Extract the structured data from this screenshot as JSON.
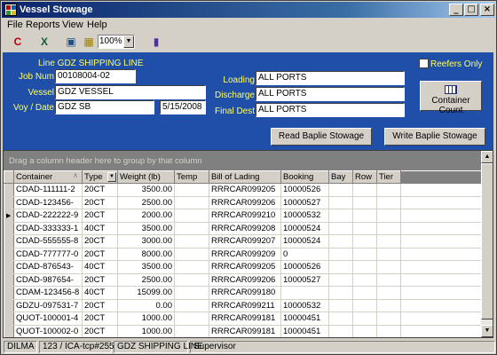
{
  "window": {
    "title": "Vessel Stowage"
  },
  "menu": [
    "File",
    "Reports",
    "View",
    "Help"
  ],
  "toolbar": {
    "zoom": "100%"
  },
  "header": {
    "line_label": "Line GDZ SHIPPING LINE",
    "job_label": "Job Num",
    "job_value": "00108004-02",
    "vessel_label": "Vessel",
    "vessel_value": "GDZ VESSEL",
    "voy_label": "Voy / Date",
    "voy_value": "GDZ SB",
    "date_value": "5/15/2008",
    "loading_label": "Loading",
    "loading_value": "ALL PORTS",
    "discharge_label": "Discharge",
    "discharge_value": "ALL PORTS",
    "finaldest_label": "Final Dest",
    "finaldest_value": "ALL PORTS",
    "reefers_label": "Reefers Only",
    "container_count_label": "Container Count",
    "read_baplie_label": "Read Baplie Stowage",
    "write_baplie_label": "Write Baplie Stowage"
  },
  "grid": {
    "group_hint": "Drag a column header here to group by that column",
    "columns": [
      "Container",
      "Type",
      "Weight (lb)",
      "Temp",
      "Bill of Lading",
      "Booking",
      "Bay",
      "Row",
      "Tier"
    ],
    "rows": [
      [
        "CDAD-111111-2",
        "20CT",
        "3500.00",
        "",
        "RRRCAR099205",
        "10000526",
        "",
        "",
        ""
      ],
      [
        "CDAD-123456-",
        "20CT",
        "2500.00",
        "",
        "RRRCAR099206",
        "10000527",
        "",
        "",
        ""
      ],
      [
        "CDAD-222222-9",
        "20CT",
        "2000.00",
        "",
        "RRRCAR099210",
        "10000532",
        "",
        "",
        ""
      ],
      [
        "CDAD-333333-1",
        "40CT",
        "3500.00",
        "",
        "RRRCAR099208",
        "10000524",
        "",
        "",
        ""
      ],
      [
        "CDAD-555555-8",
        "20CT",
        "3000.00",
        "",
        "RRRCAR099207",
        "10000524",
        "",
        "",
        ""
      ],
      [
        "CDAD-777777-0",
        "20CT",
        "8000.00",
        "",
        "RRRCAR099209",
        "0",
        "",
        "",
        ""
      ],
      [
        "CDAD-876543-",
        "40CT",
        "3500.00",
        "",
        "RRRCAR099205",
        "10000526",
        "",
        "",
        ""
      ],
      [
        "CDAD-987654-",
        "20CT",
        "2500.00",
        "",
        "RRRCAR099206",
        "10000527",
        "",
        "",
        ""
      ],
      [
        "CDAM-123456-8",
        "40CT",
        "15099.00",
        "",
        "RRRCAR099180",
        "",
        "",
        "",
        ""
      ],
      [
        "GDZU-097531-7",
        "20CT",
        "0.00",
        "",
        "RRRCAR099211",
        "10000532",
        "",
        "",
        ""
      ],
      [
        "QUOT-100001-4",
        "20CT",
        "1000.00",
        "",
        "RRRCAR099181",
        "10000451",
        "",
        "",
        ""
      ],
      [
        "QUOT-100002-0",
        "20CT",
        "1000.00",
        "",
        "RRRCAR099181",
        "10000451",
        "",
        "",
        ""
      ]
    ],
    "current_row": 2
  },
  "status": [
    "DILMA",
    "123 / ICA-tcp#255",
    "GDZ SHIPPING LINE",
    "Supervisor"
  ]
}
